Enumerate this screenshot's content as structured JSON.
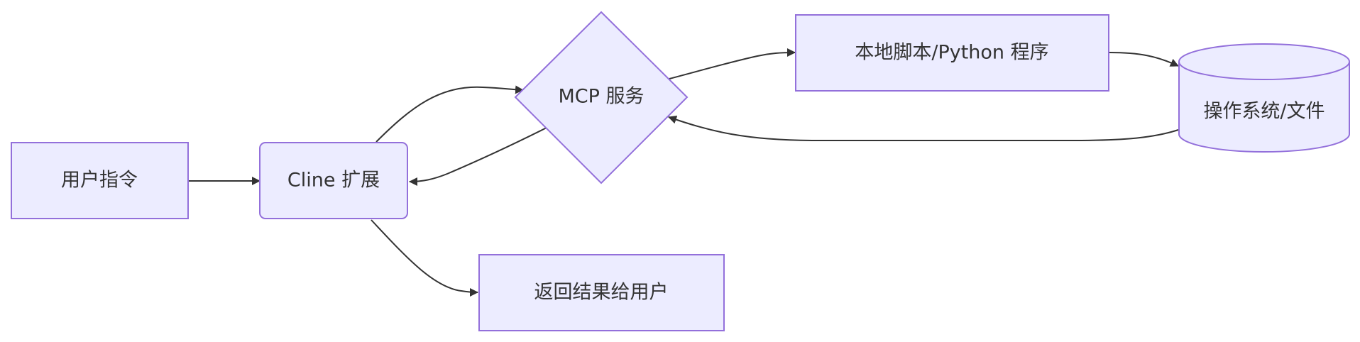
{
  "diagram": {
    "nodes": {
      "user_command": "用户指令",
      "cline_extension": "Cline 扩展",
      "mcp_service": "MCP 服务",
      "local_script": "本地脚本/Python 程序",
      "os_file": "操作系统/文件",
      "return_result": "返回结果给用户"
    },
    "edges": [
      {
        "from": "user_command",
        "to": "cline_extension"
      },
      {
        "from": "cline_extension",
        "to": "mcp_service"
      },
      {
        "from": "mcp_service",
        "to": "cline_extension"
      },
      {
        "from": "mcp_service",
        "to": "local_script"
      },
      {
        "from": "local_script",
        "to": "os_file"
      },
      {
        "from": "os_file",
        "to": "mcp_service"
      },
      {
        "from": "cline_extension",
        "to": "return_result"
      }
    ],
    "colors": {
      "node_fill": "#ECECFF",
      "node_stroke": "#9370DB",
      "edge": "#333333",
      "text": "#333333"
    }
  }
}
